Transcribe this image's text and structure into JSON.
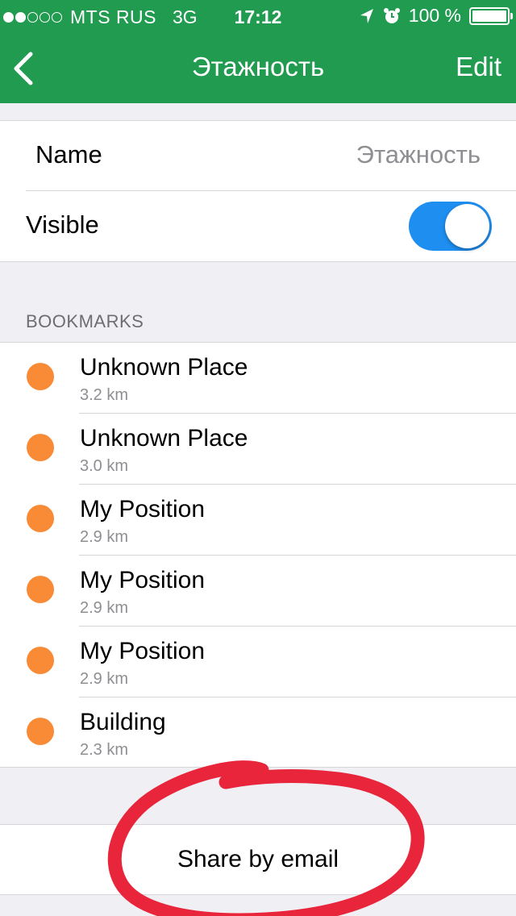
{
  "status": {
    "carrier": "MTS RUS",
    "network": "3G",
    "time": "17:12",
    "battery": "100 %",
    "signal_bars_filled": 2,
    "signal_bars_total": 5
  },
  "nav": {
    "title": "Этажность",
    "edit_label": "Edit",
    "back_icon": "chevron-left-icon"
  },
  "settings": {
    "name_label": "Name",
    "name_value": "Этажность",
    "visible_label": "Visible",
    "visible_on": true
  },
  "bookmarks": {
    "header": "BOOKMARKS",
    "items": [
      {
        "title": "Unknown Place",
        "distance": "3.2 km"
      },
      {
        "title": "Unknown Place",
        "distance": "3.0 km"
      },
      {
        "title": "My Position",
        "distance": "2.9 km"
      },
      {
        "title": "My Position",
        "distance": "2.9 km"
      },
      {
        "title": "My Position",
        "distance": "2.9 km"
      },
      {
        "title": "Building",
        "distance": "2.3 km"
      }
    ]
  },
  "share_label": "Share by email",
  "colors": {
    "nav_bar": "#219b50",
    "toggle_on": "#1e8ef0",
    "bookmark_dot": "#f98a36",
    "annotation": "#e8253a"
  }
}
